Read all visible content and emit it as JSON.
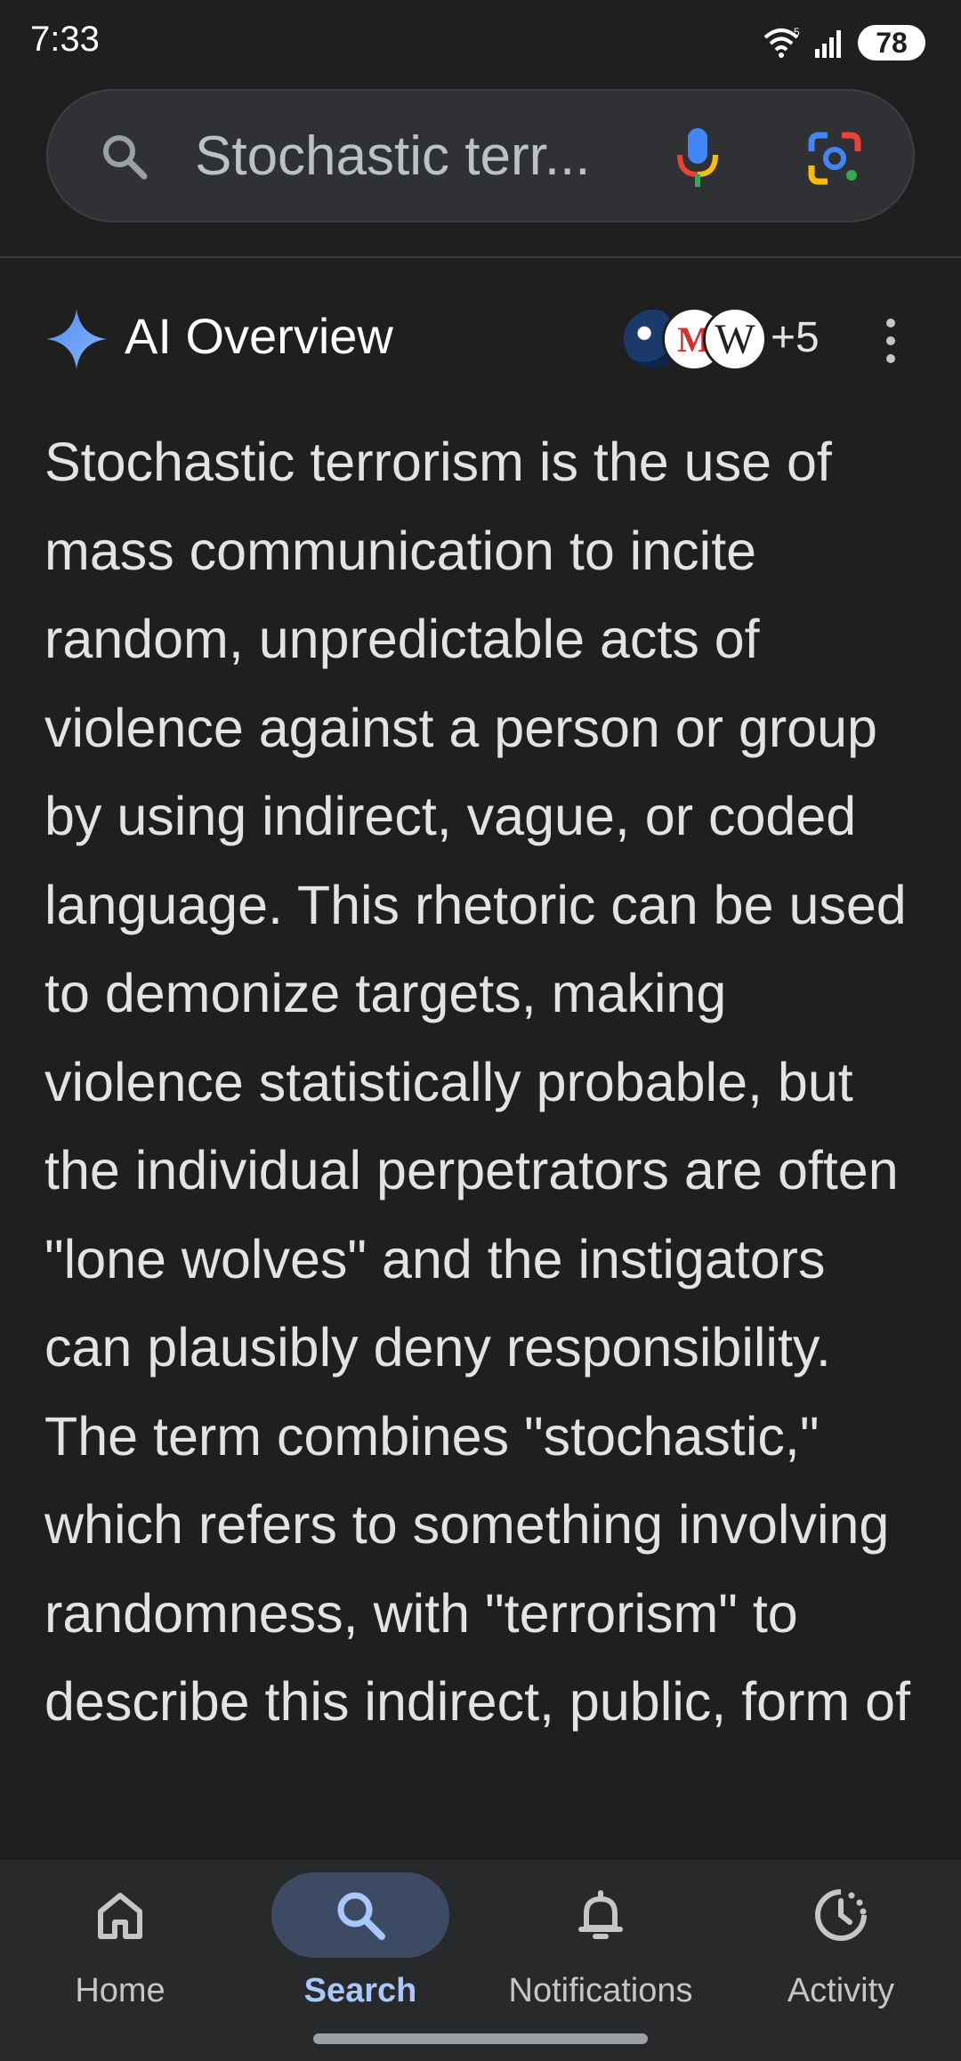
{
  "status_bar": {
    "time": "7:33",
    "battery": "78",
    "icons": [
      "wifi-icon",
      "signal-icon",
      "battery-icon"
    ]
  },
  "search": {
    "query": "Stochastic terr...",
    "icons": [
      "search-icon",
      "mic-icon",
      "google-lens-icon"
    ]
  },
  "ai_overview": {
    "title": "AI Overview",
    "more_sources": "+5",
    "source_icons": [
      "source-favicon-1",
      "source-favicon-2",
      "wikipedia-icon"
    ],
    "paragraph": "Stochastic terrorism is the use of mass communication to incite random, unpredictable acts of violence against a person or group by using indirect, vague, or coded language. This rhetoric can be used to demonize targets, making violence statistically probable, but the individual perpetrators are often \"lone wolves\" and the instigators can plausibly deny responsibility. The term combines \"stochastic,\" which refers to something involving randomness, with \"terrorism\" to describe this indirect, public, form of"
  },
  "bottom_nav": {
    "items": [
      {
        "label": "Home",
        "icon": "home-icon"
      },
      {
        "label": "Search",
        "icon": "search-icon",
        "active": true
      },
      {
        "label": "Notifications",
        "icon": "bell-icon"
      },
      {
        "label": "Activity",
        "icon": "activity-icon"
      }
    ]
  },
  "colors": {
    "background": "#1f1f1f",
    "search_bar": "#303134",
    "nav_bar": "#28292a",
    "active_accent": "#a8c7fa",
    "active_pill": "#3c4a63"
  }
}
